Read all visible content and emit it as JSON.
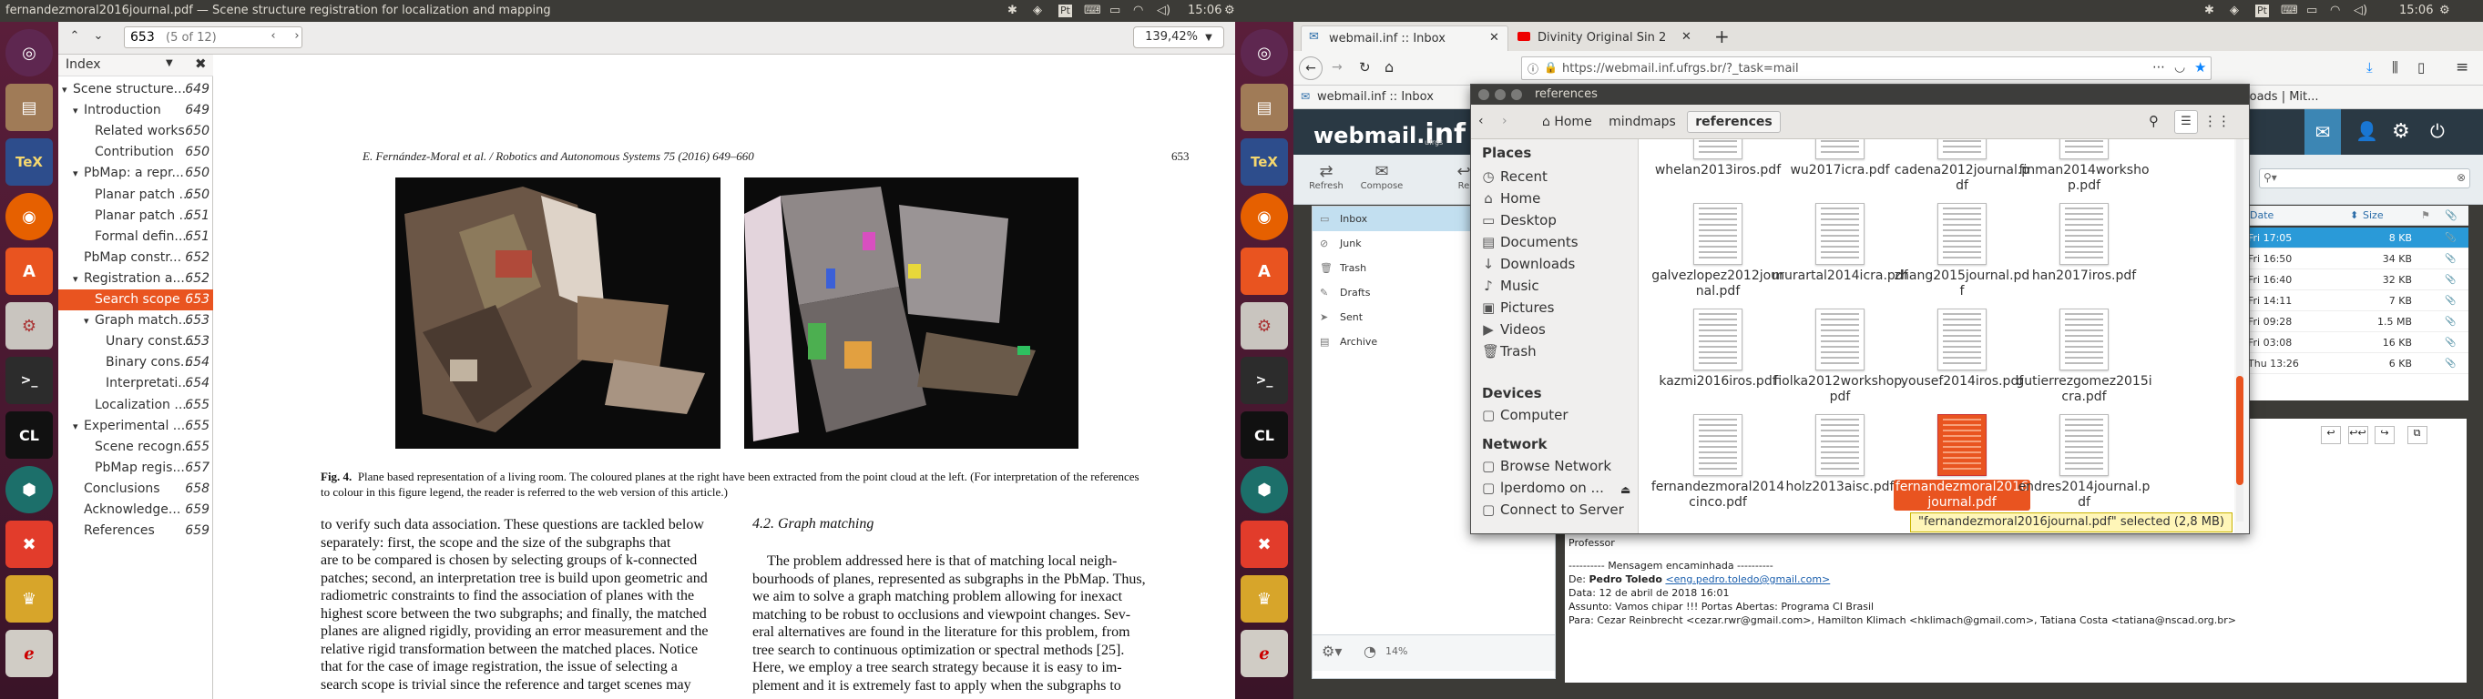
{
  "left_topbar": {
    "title": "fernandezmoral2016journal.pdf — Scene structure registration for localization and mapping",
    "time": "15:06"
  },
  "right_topbar": {
    "time": "15:06"
  },
  "evince": {
    "page_input": "653",
    "page_count": "(5 of 12)",
    "zoom": "139,42%",
    "index_label": "Index",
    "outline": [
      {
        "t": "Scene structure...",
        "p": "649",
        "lvl": 0,
        "sel": false
      },
      {
        "t": "Introduction",
        "p": "649",
        "lvl": 1,
        "sel": false
      },
      {
        "t": "Related works",
        "p": "650",
        "lvl": 2,
        "sel": false
      },
      {
        "t": "Contribution",
        "p": "650",
        "lvl": 2,
        "sel": false
      },
      {
        "t": "PbMap: a repr...",
        "p": "650",
        "lvl": 1,
        "sel": false
      },
      {
        "t": "Planar patch ...",
        "p": "650",
        "lvl": 2,
        "sel": false
      },
      {
        "t": "Planar patch ...",
        "p": "651",
        "lvl": 2,
        "sel": false
      },
      {
        "t": "Formal defin...",
        "p": "651",
        "lvl": 2,
        "sel": false
      },
      {
        "t": "PbMap constr...",
        "p": "652",
        "lvl": 1,
        "sel": false
      },
      {
        "t": "Registration a...",
        "p": "652",
        "lvl": 1,
        "sel": false
      },
      {
        "t": "Search scope",
        "p": "653",
        "lvl": 2,
        "sel": true
      },
      {
        "t": "Graph match...",
        "p": "653",
        "lvl": 2,
        "sel": false
      },
      {
        "t": "Unary const...",
        "p": "653",
        "lvl": 3,
        "sel": false
      },
      {
        "t": "Binary cons...",
        "p": "654",
        "lvl": 3,
        "sel": false
      },
      {
        "t": "Interpretati...",
        "p": "654",
        "lvl": 3,
        "sel": false
      },
      {
        "t": "Localization ...",
        "p": "655",
        "lvl": 2,
        "sel": false
      },
      {
        "t": "Experimental ...",
        "p": "655",
        "lvl": 1,
        "sel": false
      },
      {
        "t": "Scene recogn...",
        "p": "655",
        "lvl": 2,
        "sel": false
      },
      {
        "t": "PbMap regis...",
        "p": "657",
        "lvl": 2,
        "sel": false
      },
      {
        "t": "Conclusions",
        "p": "658",
        "lvl": 1,
        "sel": false
      },
      {
        "t": "Acknowledge...",
        "p": "659",
        "lvl": 1,
        "sel": false
      },
      {
        "t": "References",
        "p": "659",
        "lvl": 1,
        "sel": false
      }
    ],
    "page": {
      "header": "E. Fernández-Moral et al. / Robotics and Autonomous Systems 75 (2016) 649–660",
      "page_no": "653",
      "fig_label": "Fig. 4.",
      "caption": "Plane based representation of a living room. The coloured planes at the right have been extracted from the point cloud at the left. (For interpretation of the references to colour in this figure legend, the reader is referred to the web version of this article.)",
      "col_left": [
        "to verify such data association. These questions are tackled below",
        "separately: first, the scope and the size of the subgraphs that",
        "are to be compared is chosen by selecting groups of k-connected",
        "patches; second, an interpretation tree is build upon geometric and",
        "radiometric constraints to find the association of planes with the",
        "highest score between the two subgraphs; and finally, the matched",
        "planes are aligned rigidly, providing an error measurement and the",
        "relative rigid transformation between the matched places. Notice",
        "that for the case of image registration, the issue of selecting a",
        "search scope is trivial since the reference and target scenes may"
      ],
      "section": "4.2.  Graph matching",
      "col_right": [
        "The problem addressed here is that of matching local neigh-",
        "bourhoods of planes, represented as subgraphs in the PbMap. Thus,",
        "we aim to solve a graph matching problem allowing for inexact",
        "matching to be robust to occlusions and viewpoint changes. Sev-",
        "eral alternatives are found in the literature for this problem, from",
        "tree search to continuous optimization or spectral methods [25].",
        "Here, we employ a tree search strategy because it is easy to im-",
        "plement and it is extremely fast to apply when the subgraphs to"
      ]
    }
  },
  "firefox": {
    "tabs": [
      {
        "label": "webmail.inf :: Inbox"
      },
      {
        "label": "Divinity Original Sin 2"
      }
    ],
    "url": "https://webmail.inf.ufrgs.br/?_task=mail",
    "bookmark_left": "webmail.inf :: Inbox",
    "bookmark_right": "loads | Mit..."
  },
  "webmail": {
    "logo_a": "webmail.",
    "logo_b": "inf",
    "logo_c": "ufrgs",
    "tools": [
      "Refresh",
      "Compose",
      "Re"
    ],
    "folders": [
      "Inbox",
      "Junk",
      "Trash",
      "Drafts",
      "Sent",
      "Archive"
    ],
    "quota": "14%",
    "list_header": {
      "date": "Date",
      "size": "Size"
    },
    "rows": [
      {
        "date": "Fri 17:05",
        "size": "8 KB",
        "sel": true
      },
      {
        "date": "Fri 16:50",
        "size": "34 KB",
        "sel": false
      },
      {
        "date": "Fri 16:40",
        "size": "32 KB",
        "sel": false
      },
      {
        "date": "Fri 14:11",
        "size": "7 KB",
        "sel": false
      },
      {
        "date": "Fri 09:28",
        "size": "1.5 MB",
        "sel": false
      },
      {
        "date": "Fri 03:08",
        "size": "16 KB",
        "sel": false
      },
      {
        "date": "Thu 13:26",
        "size": "6 KB",
        "sel": false
      }
    ],
    "message": {
      "professor": "Professor",
      "fwd": "---------- Mensagem encaminhada ----------",
      "from_label": "De: ",
      "from_name": "Pedro Toledo",
      "from_mail": "<eng.pedro.toledo@gmail.com>",
      "date": "Data: 12 de abril de 2018 16:01",
      "subject": "Assunto: Vamos chipar !!! Portas Abertas: Programa CI Brasil",
      "to": "Para: Cezar Reinbrecht <cezar.rwr@gmail.com>, Hamilton Klimach <hklimach@gmail.com>, Tatiana Costa <tatiana@nscad.org.br>"
    }
  },
  "files": {
    "title": "references",
    "path": [
      "Home",
      "mindmaps",
      "references"
    ],
    "places_head": "Places",
    "places": [
      {
        "icon": "recent-icon",
        "g": "◷",
        "t": "Recent"
      },
      {
        "icon": "home-icon",
        "g": "⌂",
        "t": "Home"
      },
      {
        "icon": "desktop-icon",
        "g": "▭",
        "t": "Desktop"
      },
      {
        "icon": "documents-icon",
        "g": "▤",
        "t": "Documents"
      },
      {
        "icon": "downloads-icon",
        "g": "↓",
        "t": "Downloads"
      },
      {
        "icon": "music-icon",
        "g": "♪",
        "t": "Music"
      },
      {
        "icon": "pictures-icon",
        "g": "▣",
        "t": "Pictures"
      },
      {
        "icon": "videos-icon",
        "g": "▶",
        "t": "Videos"
      },
      {
        "icon": "trash-icon",
        "g": "🗑",
        "t": "Trash"
      }
    ],
    "devices_head": "Devices",
    "devices": [
      {
        "icon": "computer-icon",
        "g": "▢",
        "t": "Computer"
      }
    ],
    "network_head": "Network",
    "network": [
      {
        "icon": "network-icon",
        "g": "▢",
        "t": "Browse Network"
      },
      {
        "icon": "server-icon",
        "g": "▢",
        "t": "lperdomo on ..."
      },
      {
        "icon": "connect-icon",
        "g": "▢",
        "t": "Connect to Server"
      }
    ],
    "files": [
      [
        "whelan2013iros.pdf",
        "wu2017icra.pdf",
        "cadena2012journal.pdf",
        "finman2014workshop.pdf"
      ],
      [
        "galvezlopez2012journal.pdf",
        "murartal2014icra.pdf",
        "zhang2015journal.pdf",
        "han2017iros.pdf"
      ],
      [
        "kazmi2016iros.pdf",
        "fiolka2012workshop.pdf",
        "yousef2014iros.pdf",
        "gutierrezgomez2015icra.pdf"
      ],
      [
        "fernandezmoral2014cinco.pdf",
        "holz2013aisc.pdf",
        "fernandezmoral2016journal.pdf",
        "endres2014journal.pdf"
      ]
    ],
    "status": "\"fernandezmoral2016journal.pdf\" selected (2,8 MB)"
  }
}
